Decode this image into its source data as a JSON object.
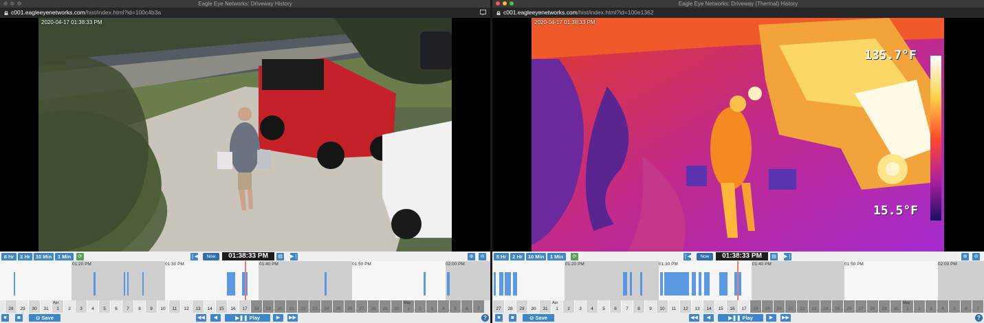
{
  "left": {
    "title": "Eagle Eye Networks: Driveway History",
    "url_host": "c001.eagleeyenetworks.com",
    "url_path": "/hist/index.html?id=100c4b3a",
    "timestamp": "2020-04-17 01:38:33 PM",
    "ranges": [
      "8 Hr",
      "2 Hr",
      "10 Min",
      "1 Min"
    ],
    "now_label": "Now",
    "clock": "01:38:33 PM",
    "time_labels": [
      "01:20 PM",
      "01:30 PM",
      "01:40 PM",
      "01:50 PM",
      "02:00 PM"
    ],
    "days": [
      "28",
      "29",
      "30",
      "31",
      "1",
      "2",
      "3",
      "4",
      "5",
      "6",
      "7",
      "8",
      "9",
      "10",
      "11",
      "12",
      "13",
      "14",
      "15",
      "16",
      "17",
      "18",
      "19",
      "20",
      "21",
      "22",
      "23",
      "24",
      "25",
      "26",
      "27",
      "28",
      "29",
      "30",
      "1",
      "2",
      "3",
      "4",
      "5",
      "6",
      "7"
    ],
    "month_labels": [
      "Apr",
      "May"
    ],
    "save": "Save",
    "play": "Play"
  },
  "right": {
    "title": "Eagle Eye Networks: Driveway (Thermal) History",
    "url_host": "c001.eagleeyenetworks.com",
    "url_path": "/hist/index.html?id=100e1362",
    "timestamp": "2020-04-17 01:38:33 PM",
    "temp_high": "135.7°F",
    "temp_low": "15.5°F",
    "ranges": [
      "8 Hr",
      "2 Hr",
      "10 Min",
      "1 Min"
    ],
    "now_label": "Now",
    "clock": "01:38:33 PM",
    "time_labels": [
      "01:20 PM",
      "01:30 PM",
      "01:40 PM",
      "01:50 PM",
      "02:00 PM"
    ],
    "days": [
      "27",
      "28",
      "29",
      "30",
      "31",
      "1",
      "2",
      "3",
      "4",
      "5",
      "6",
      "7",
      "8",
      "9",
      "10",
      "11",
      "12",
      "13",
      "14",
      "15",
      "16",
      "17",
      "18",
      "19",
      "20",
      "21",
      "22",
      "23",
      "24",
      "25",
      "26",
      "27",
      "28",
      "29",
      "30",
      "1",
      "2",
      "3",
      "4",
      "5",
      "6",
      "7"
    ],
    "month_labels": [
      "Apr",
      "May"
    ],
    "save": "Save",
    "play": "Play"
  },
  "colors": {
    "accent": "#3f86c8",
    "event": "#4a8fe0",
    "cursor": "#e97b7b"
  }
}
